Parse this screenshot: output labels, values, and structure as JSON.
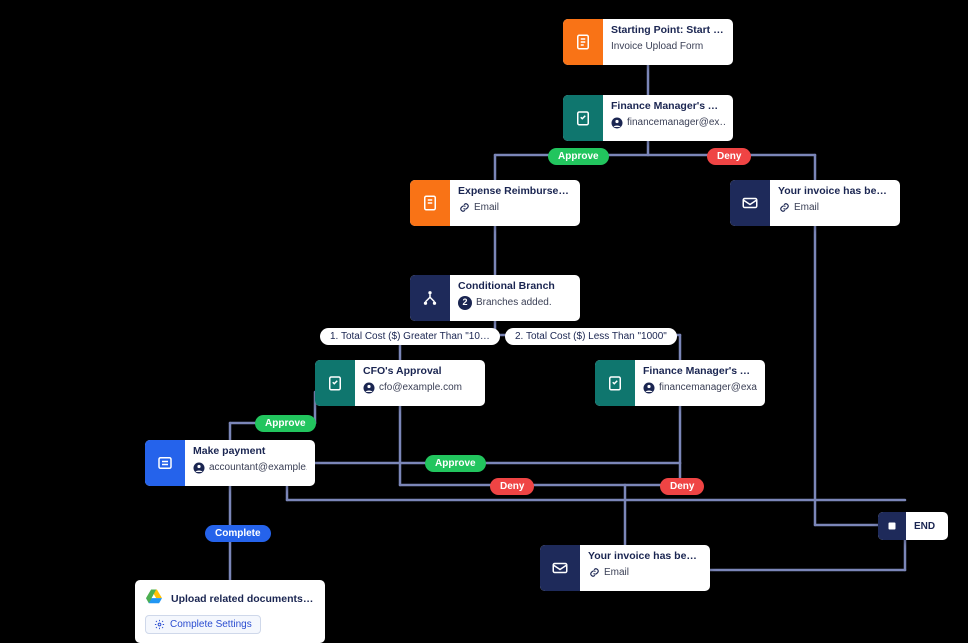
{
  "colors": {
    "orange": "#f97316",
    "green": "#0f766e",
    "navy": "#1e2a5a",
    "blue": "#2563eb",
    "approve": "#22c55e",
    "deny": "#ef4444",
    "connector": "#7b86b8"
  },
  "nodes": {
    "start": {
      "title": "Starting Point: Start Point",
      "subtitle": "Invoice Upload Form"
    },
    "fm1": {
      "title": "Finance Manager's Approval",
      "subtitle": "financemanager@ex…"
    },
    "expense": {
      "title": "Expense Reimbursement Form",
      "subtitle": "Email"
    },
    "denied1": {
      "title": "Your invoice has been denied.",
      "subtitle": "Email"
    },
    "branch": {
      "title": "Conditional Branch",
      "subtitle": "Branches added.",
      "count": "2"
    },
    "cfo": {
      "title": "CFO's Approval",
      "subtitle": "cfo@example.com"
    },
    "fm2": {
      "title": "Finance Manager's Approval",
      "subtitle": "financemanager@exa…"
    },
    "payment": {
      "title": "Make payment",
      "subtitle": "accountant@example.…"
    },
    "denied2": {
      "title": "Your invoice has been denied.",
      "subtitle": "Email"
    },
    "gdrive": {
      "title": "Upload related documents to…",
      "button": "Complete Settings"
    },
    "end": {
      "label": "END"
    }
  },
  "pills": {
    "approve1": "Approve",
    "deny1": "Deny",
    "cond1": "1. Total Cost ($) Greater Than \"10…",
    "cond2": "2. Total Cost ($) Less Than \"1000\"",
    "approve_cfo": "Approve",
    "approve_fm2": "Approve",
    "deny_cfo": "Deny",
    "deny_fm2": "Deny",
    "complete": "Complete"
  }
}
